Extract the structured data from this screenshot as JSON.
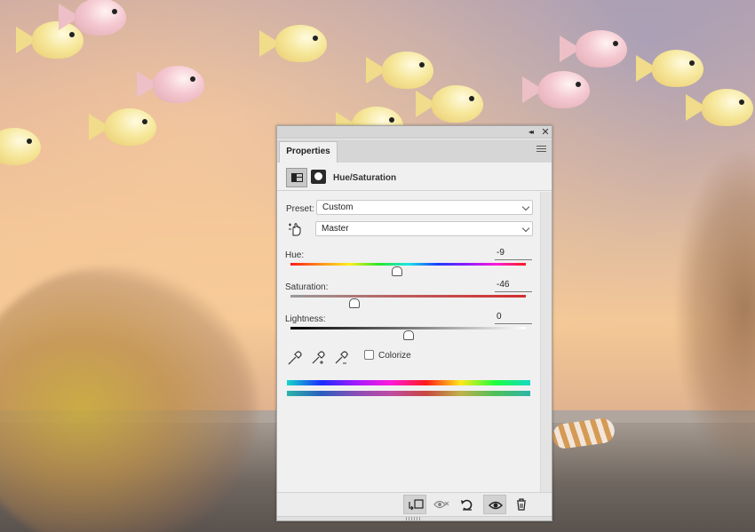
{
  "panel": {
    "tab_label": "Properties",
    "collapse_icon": "double-chevron-left-icon",
    "close_icon": "close-icon",
    "menu_icon": "panel-menu-icon"
  },
  "adjustment": {
    "title": "Hue/Saturation",
    "preset_label": "Preset:",
    "preset_value": "Custom",
    "channel_value": "Master"
  },
  "sliders": {
    "hue": {
      "label": "Hue:",
      "value": "-9"
    },
    "saturation": {
      "label": "Saturation:",
      "value": "-46"
    },
    "lightness": {
      "label": "Lightness:",
      "value": "0"
    }
  },
  "colorize": {
    "label": "Colorize",
    "checked": false
  },
  "footer_buttons": [
    {
      "icon": "clip-to-layer-icon"
    },
    {
      "icon": "view-previous-state-icon"
    },
    {
      "icon": "reset-icon"
    },
    {
      "icon": "toggle-visibility-icon"
    },
    {
      "icon": "trash-icon"
    }
  ]
}
